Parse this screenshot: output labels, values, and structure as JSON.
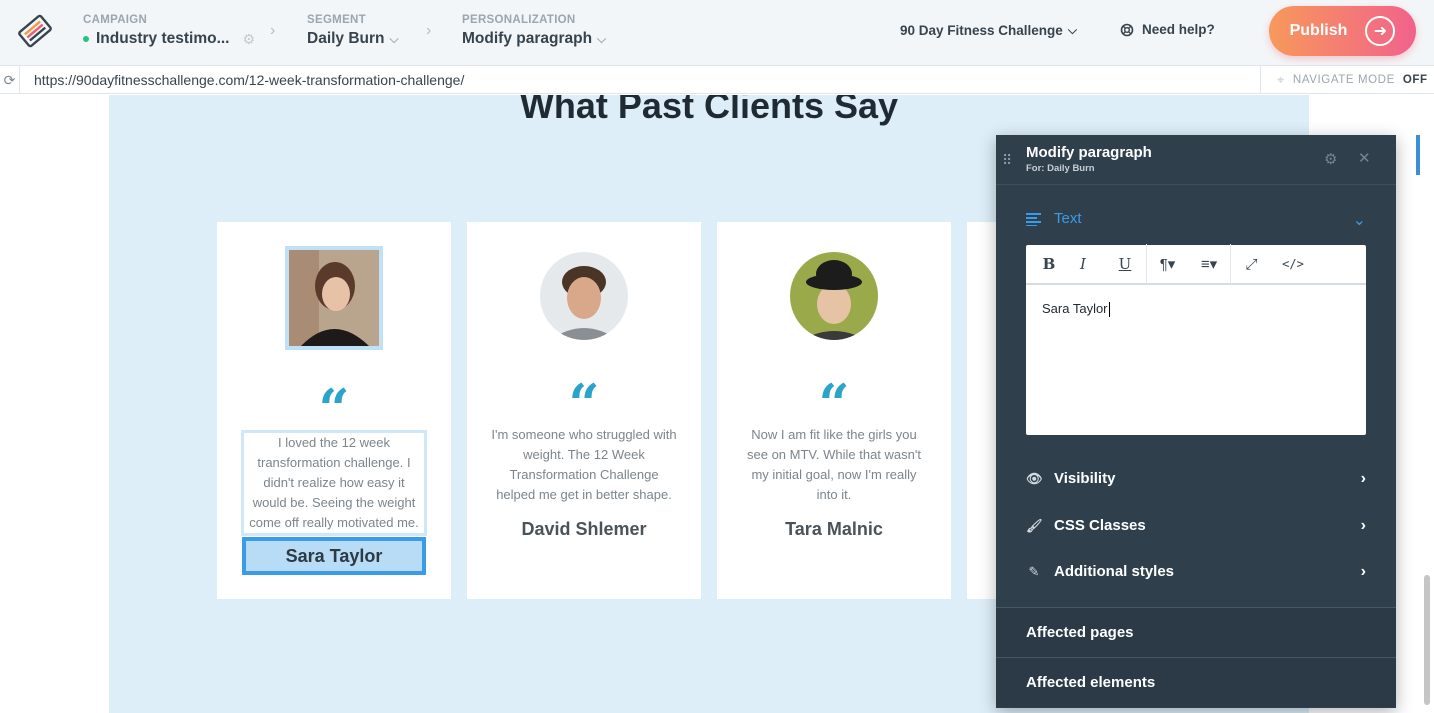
{
  "topbar": {
    "campaign": {
      "label": "CAMPAIGN",
      "value": "Industry testimo..."
    },
    "segment": {
      "label": "SEGMENT",
      "value": "Daily Burn"
    },
    "personalization": {
      "label": "PERSONALIZATION",
      "value": "Modify paragraph"
    },
    "account": "90 Day Fitness Challenge",
    "help": "Need help?",
    "publish": "Publish"
  },
  "urlbar": {
    "url": "https://90dayfitnesschallenge.com/12-week-transformation-challenge/",
    "navigate_mode_label": "NAVIGATE MODE",
    "navigate_mode_state": "OFF"
  },
  "page": {
    "heading": "What Past Clients Say",
    "testimonials": [
      {
        "text": "I loved the 12 week transformation challenge. I didn't realize how easy it would be. Seeing the weight come off really motivated me.",
        "name": "Sara Taylor"
      },
      {
        "text": "I'm someone who struggled with weight. The 12 Week Transformation Challenge helped me get in better shape.",
        "name": "David Shlemer"
      },
      {
        "text": "Now I am fit like the girls you see on MTV. While that wasn't my initial goal, now I'm really into it.",
        "name": "Tara Malnic"
      }
    ]
  },
  "panel": {
    "title": "Modify paragraph",
    "subtitle": "For: Daily Burn",
    "text_section": "Text",
    "editor_value": "Sara Taylor",
    "visibility": "Visibility",
    "css_classes": "CSS Classes",
    "additional_styles": "Additional styles",
    "affected_pages": "Affected pages",
    "affected_elements": "Affected elements"
  },
  "colors": {
    "accent": "#3a9be8",
    "publish_start": "#f7995b",
    "publish_end": "#f1628b",
    "quote": "#2ca3c9",
    "panel_bg": "#2f3f4c"
  }
}
